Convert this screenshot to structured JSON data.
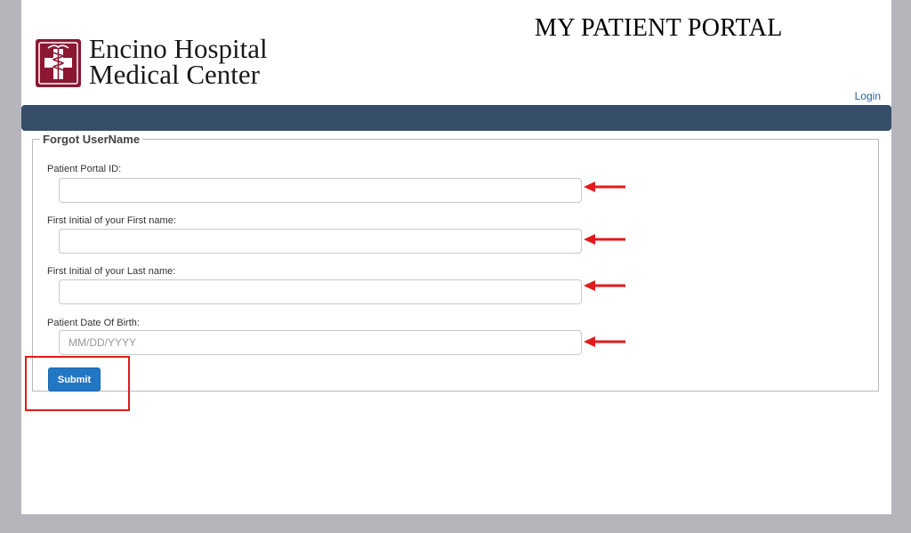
{
  "header": {
    "logo_line1": "Encino Hospital",
    "logo_line2": "Medical Center",
    "portal_title": "MY PATIENT PORTAL",
    "login_link": "Login"
  },
  "form": {
    "legend": "Forgot UserName",
    "fields": [
      {
        "label": "Patient Portal ID:",
        "value": "",
        "placeholder": ""
      },
      {
        "label": "First Initial of your First name:",
        "value": "",
        "placeholder": ""
      },
      {
        "label": "First Initial of your Last name:",
        "value": "",
        "placeholder": ""
      },
      {
        "label": "Patient Date Of Birth:",
        "value": "",
        "placeholder": "MM/DD/YYYY"
      }
    ],
    "submit_label": "Submit"
  },
  "colors": {
    "navbar": "#374e68",
    "submit_button": "#2277c4",
    "annotation_red": "#e11b1b",
    "logo_maroon": "#8b1732"
  },
  "icons": {
    "logo": "hospital-cross-caduceus-icon",
    "annotation": "red-arrow-left-icon"
  }
}
